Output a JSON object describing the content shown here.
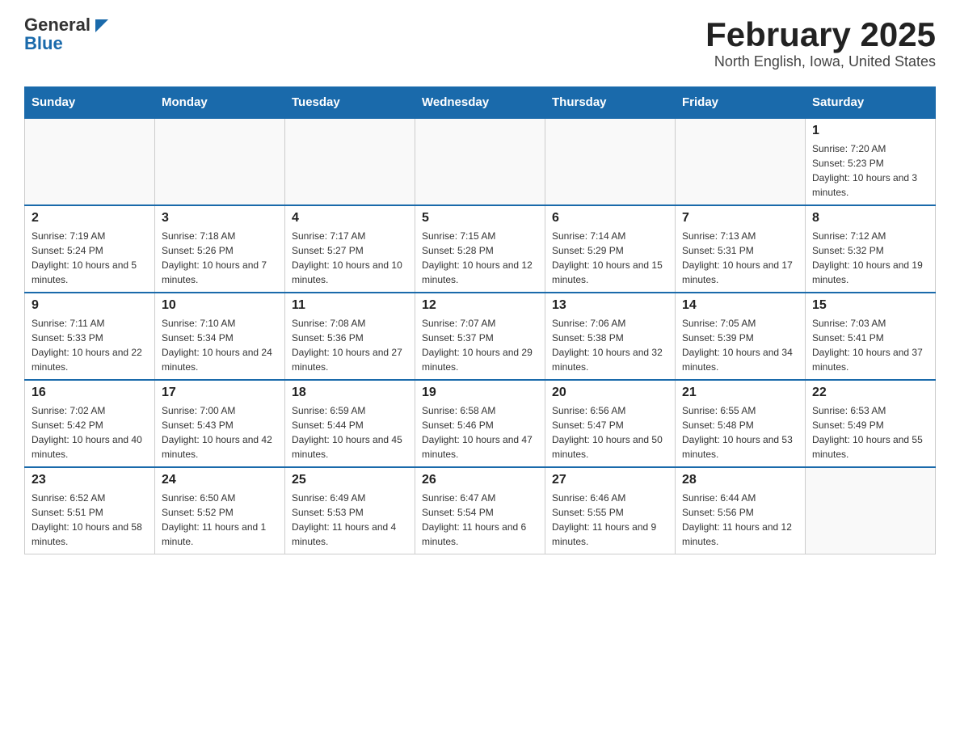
{
  "header": {
    "logo_general": "General",
    "logo_blue": "Blue",
    "title": "February 2025",
    "location": "North English, Iowa, United States"
  },
  "weekdays": [
    "Sunday",
    "Monday",
    "Tuesday",
    "Wednesday",
    "Thursday",
    "Friday",
    "Saturday"
  ],
  "weeks": [
    [
      {
        "day": "",
        "info": ""
      },
      {
        "day": "",
        "info": ""
      },
      {
        "day": "",
        "info": ""
      },
      {
        "day": "",
        "info": ""
      },
      {
        "day": "",
        "info": ""
      },
      {
        "day": "",
        "info": ""
      },
      {
        "day": "1",
        "info": "Sunrise: 7:20 AM\nSunset: 5:23 PM\nDaylight: 10 hours and 3 minutes."
      }
    ],
    [
      {
        "day": "2",
        "info": "Sunrise: 7:19 AM\nSunset: 5:24 PM\nDaylight: 10 hours and 5 minutes."
      },
      {
        "day": "3",
        "info": "Sunrise: 7:18 AM\nSunset: 5:26 PM\nDaylight: 10 hours and 7 minutes."
      },
      {
        "day": "4",
        "info": "Sunrise: 7:17 AM\nSunset: 5:27 PM\nDaylight: 10 hours and 10 minutes."
      },
      {
        "day": "5",
        "info": "Sunrise: 7:15 AM\nSunset: 5:28 PM\nDaylight: 10 hours and 12 minutes."
      },
      {
        "day": "6",
        "info": "Sunrise: 7:14 AM\nSunset: 5:29 PM\nDaylight: 10 hours and 15 minutes."
      },
      {
        "day": "7",
        "info": "Sunrise: 7:13 AM\nSunset: 5:31 PM\nDaylight: 10 hours and 17 minutes."
      },
      {
        "day": "8",
        "info": "Sunrise: 7:12 AM\nSunset: 5:32 PM\nDaylight: 10 hours and 19 minutes."
      }
    ],
    [
      {
        "day": "9",
        "info": "Sunrise: 7:11 AM\nSunset: 5:33 PM\nDaylight: 10 hours and 22 minutes."
      },
      {
        "day": "10",
        "info": "Sunrise: 7:10 AM\nSunset: 5:34 PM\nDaylight: 10 hours and 24 minutes."
      },
      {
        "day": "11",
        "info": "Sunrise: 7:08 AM\nSunset: 5:36 PM\nDaylight: 10 hours and 27 minutes."
      },
      {
        "day": "12",
        "info": "Sunrise: 7:07 AM\nSunset: 5:37 PM\nDaylight: 10 hours and 29 minutes."
      },
      {
        "day": "13",
        "info": "Sunrise: 7:06 AM\nSunset: 5:38 PM\nDaylight: 10 hours and 32 minutes."
      },
      {
        "day": "14",
        "info": "Sunrise: 7:05 AM\nSunset: 5:39 PM\nDaylight: 10 hours and 34 minutes."
      },
      {
        "day": "15",
        "info": "Sunrise: 7:03 AM\nSunset: 5:41 PM\nDaylight: 10 hours and 37 minutes."
      }
    ],
    [
      {
        "day": "16",
        "info": "Sunrise: 7:02 AM\nSunset: 5:42 PM\nDaylight: 10 hours and 40 minutes."
      },
      {
        "day": "17",
        "info": "Sunrise: 7:00 AM\nSunset: 5:43 PM\nDaylight: 10 hours and 42 minutes."
      },
      {
        "day": "18",
        "info": "Sunrise: 6:59 AM\nSunset: 5:44 PM\nDaylight: 10 hours and 45 minutes."
      },
      {
        "day": "19",
        "info": "Sunrise: 6:58 AM\nSunset: 5:46 PM\nDaylight: 10 hours and 47 minutes."
      },
      {
        "day": "20",
        "info": "Sunrise: 6:56 AM\nSunset: 5:47 PM\nDaylight: 10 hours and 50 minutes."
      },
      {
        "day": "21",
        "info": "Sunrise: 6:55 AM\nSunset: 5:48 PM\nDaylight: 10 hours and 53 minutes."
      },
      {
        "day": "22",
        "info": "Sunrise: 6:53 AM\nSunset: 5:49 PM\nDaylight: 10 hours and 55 minutes."
      }
    ],
    [
      {
        "day": "23",
        "info": "Sunrise: 6:52 AM\nSunset: 5:51 PM\nDaylight: 10 hours and 58 minutes."
      },
      {
        "day": "24",
        "info": "Sunrise: 6:50 AM\nSunset: 5:52 PM\nDaylight: 11 hours and 1 minute."
      },
      {
        "day": "25",
        "info": "Sunrise: 6:49 AM\nSunset: 5:53 PM\nDaylight: 11 hours and 4 minutes."
      },
      {
        "day": "26",
        "info": "Sunrise: 6:47 AM\nSunset: 5:54 PM\nDaylight: 11 hours and 6 minutes."
      },
      {
        "day": "27",
        "info": "Sunrise: 6:46 AM\nSunset: 5:55 PM\nDaylight: 11 hours and 9 minutes."
      },
      {
        "day": "28",
        "info": "Sunrise: 6:44 AM\nSunset: 5:56 PM\nDaylight: 11 hours and 12 minutes."
      },
      {
        "day": "",
        "info": ""
      }
    ]
  ]
}
